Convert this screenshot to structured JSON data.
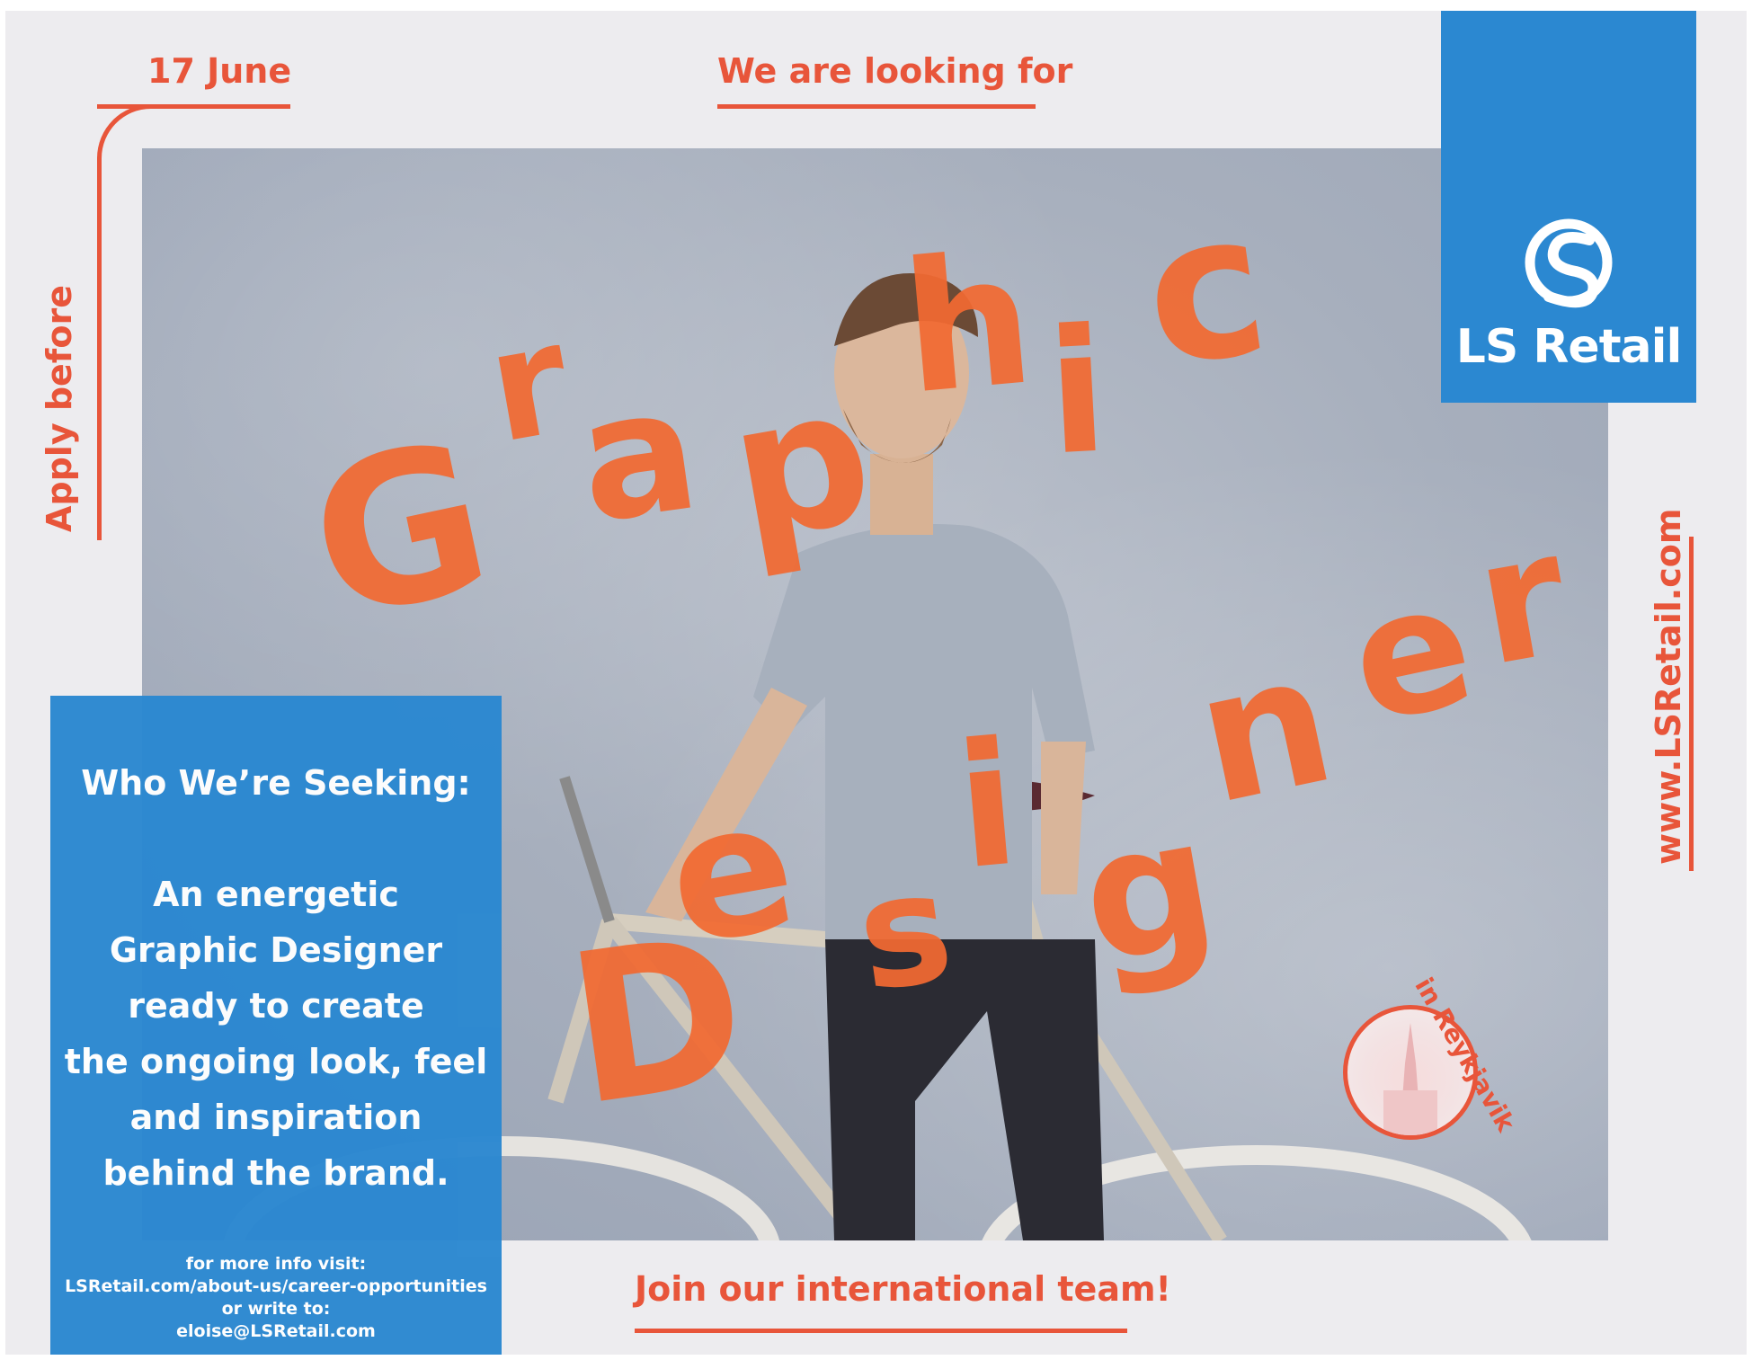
{
  "poster": {
    "apply_label": "Apply before",
    "deadline": "17 June",
    "heading": "We are looking for",
    "title_word_1": [
      "G",
      "r",
      "a",
      "p",
      "h",
      "i",
      "c"
    ],
    "title_word_2": [
      "D",
      "e",
      "s",
      "i",
      "g",
      "n",
      "e",
      "r"
    ],
    "location": "in Reykjavik",
    "website": "www.LSRetail.com",
    "footer_cta": "Join our international team!"
  },
  "logo": {
    "name": "LS Retail",
    "icon": "ls-retail-logo-icon"
  },
  "info_box": {
    "title": "Who We’re Seeking:",
    "lines": [
      "An energetic",
      "Graphic Designer",
      "ready to create",
      "the ongoing look, feel",
      "and inspiration",
      "behind the brand."
    ],
    "contact_lines": [
      "for more info visit:",
      "LSRetail.com/about-us/career-opportunities",
      "or write to:",
      "eloise@LSRetail.com"
    ]
  },
  "colors": {
    "accent_orange": "#e8553a",
    "brand_blue": "#2b88d1",
    "background": "#edecef"
  }
}
